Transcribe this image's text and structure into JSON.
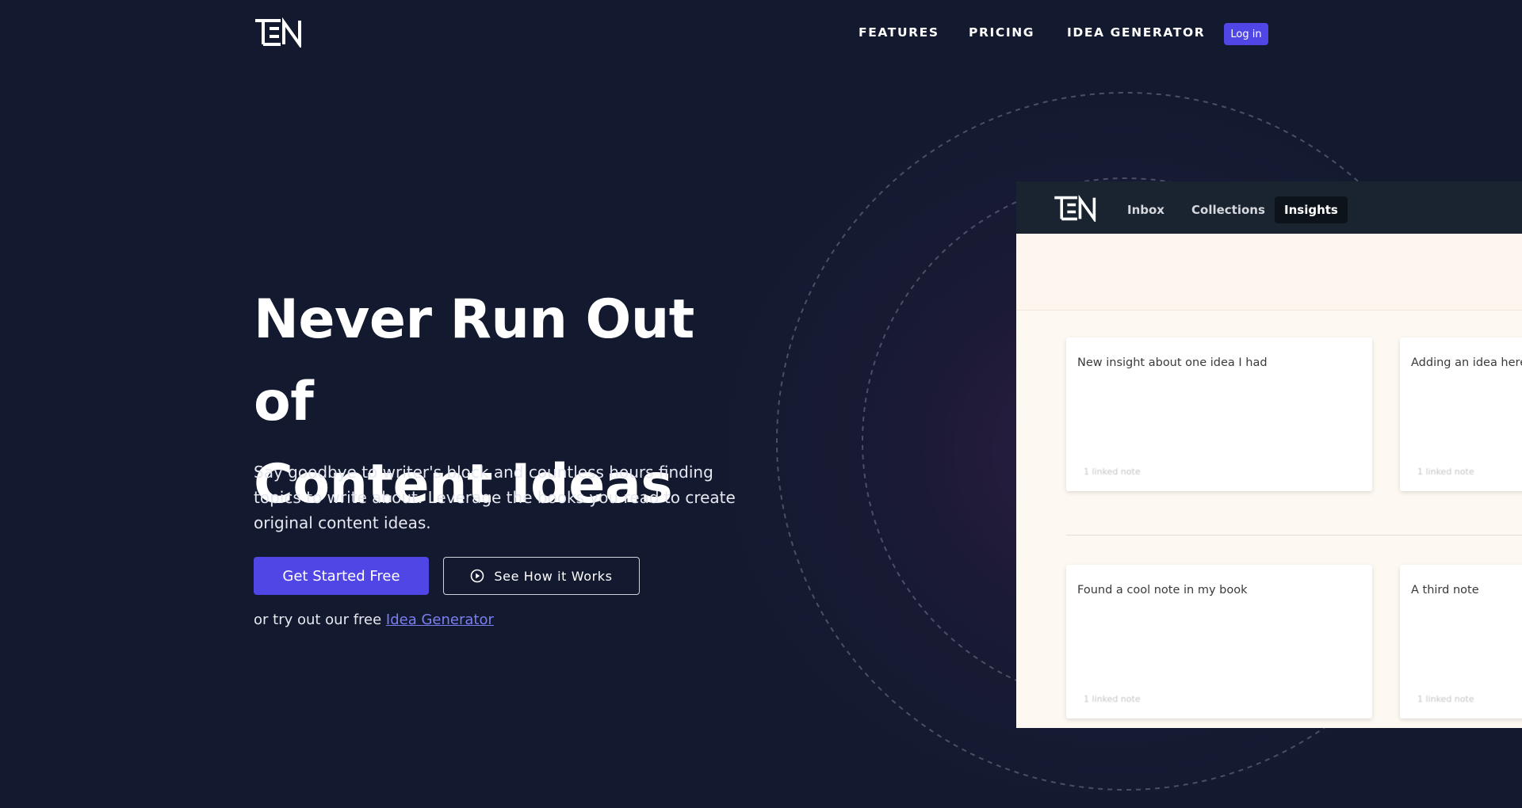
{
  "nav": {
    "links": [
      "FEATURES",
      "PRICING",
      "IDEA GENERATOR"
    ],
    "login_label": "Log in"
  },
  "hero": {
    "title_line1": "Never Run Out of",
    "title_line2": "Content Ideas",
    "subtitle": "Say goodbye to writer's block and countless hours finding topics to write about. Leverage the books you read to create original content ideas.",
    "primary_cta": "Get Started Free",
    "secondary_cta": "See How it Works",
    "try_prefix": "or try out our free ",
    "try_link": "Idea Generator"
  },
  "app_preview": {
    "tabs": [
      "Inbox",
      "Collections",
      "Insights"
    ],
    "active_tab": "Insights",
    "cards": [
      {
        "title": "New insight about one idea I had",
        "meta": "1 linked note"
      },
      {
        "title": "Adding an idea here",
        "meta": "1 linked note"
      },
      {
        "title": "Found a cool note in my book",
        "meta": "1 linked note"
      },
      {
        "title": "A third note",
        "meta": "1 linked note"
      }
    ]
  },
  "colors": {
    "background": "#131a30",
    "accent": "#5046e5",
    "link": "#7b7ff0",
    "app_header": "#1a2430",
    "app_body": "#fdf8f1"
  }
}
